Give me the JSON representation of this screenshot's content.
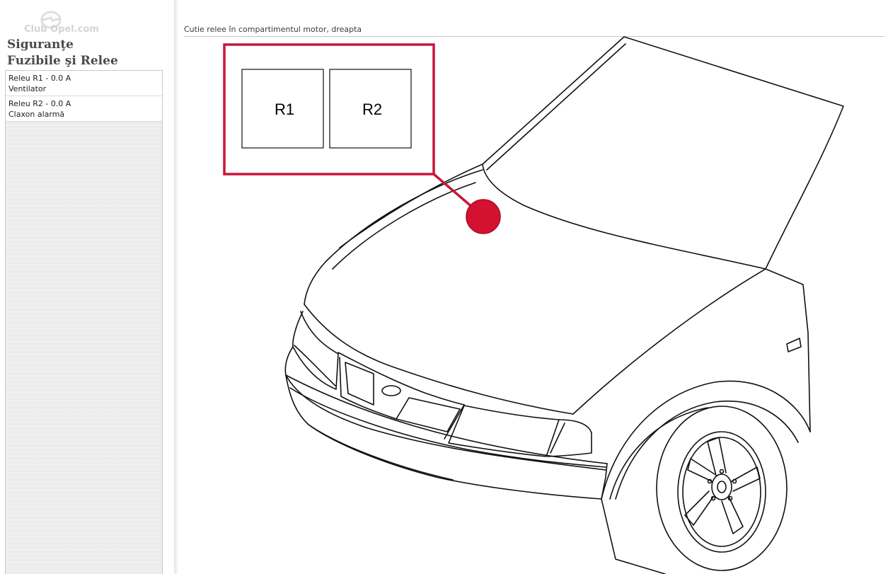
{
  "sidebar": {
    "logo_text": "Club Opel.com",
    "title_line1": "Siguranţe",
    "title_line2": "Fuzibile şi Relee",
    "items": [
      {
        "title": "Releu R1 - 0.0 A",
        "subtitle": "Ventilator"
      },
      {
        "title": "Releu R2 - 0.0 A",
        "subtitle": "Claxon alarmă"
      }
    ]
  },
  "main": {
    "caption": "Cutie relee în compartimentul motor, dreapta",
    "relays": [
      {
        "label": "R1"
      },
      {
        "label": "R2"
      }
    ]
  },
  "colors": {
    "highlight": "#c8163a",
    "marker": "#d3122f",
    "title_text": "#4a4a4a"
  }
}
